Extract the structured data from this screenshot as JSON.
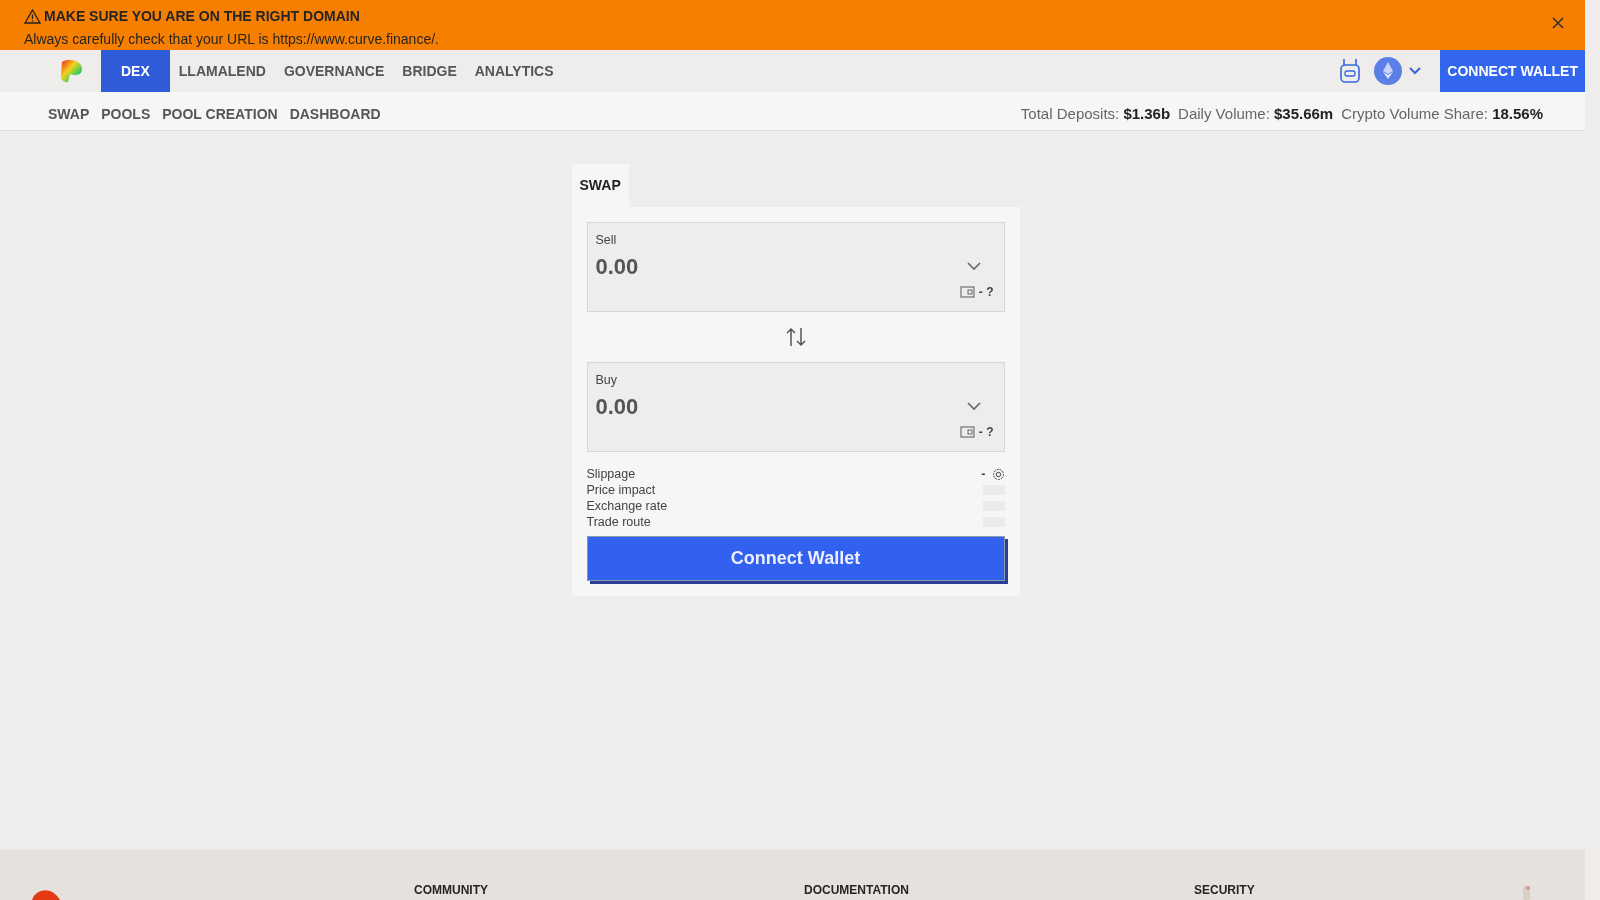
{
  "banner": {
    "title": "MAKE SURE YOU ARE ON THE RIGHT DOMAIN",
    "message": "Always carefully check that your URL is https://www.curve.finance/."
  },
  "nav": {
    "items": [
      {
        "label": "DEX",
        "selected": true
      },
      {
        "label": "LLAMALEND",
        "selected": false
      },
      {
        "label": "GOVERNANCE",
        "selected": false
      },
      {
        "label": "BRIDGE",
        "selected": false
      },
      {
        "label": "ANALYTICS",
        "selected": false
      }
    ],
    "connect": "CONNECT WALLET"
  },
  "subnav": {
    "items": [
      {
        "label": "SWAP",
        "selected": false
      },
      {
        "label": "POOLS",
        "selected": false
      },
      {
        "label": "POOL CREATION",
        "selected": false
      },
      {
        "label": "DASHBOARD",
        "selected": false
      }
    ],
    "stats": [
      {
        "label": "Total Deposits:",
        "value": "$1.36b"
      },
      {
        "label": "Daily Volume:",
        "value": "$35.66m"
      },
      {
        "label": "Crypto Volume Share:",
        "value": "18.56%"
      }
    ]
  },
  "swap": {
    "tabs": [
      {
        "label": "SWAP",
        "selected": true
      }
    ],
    "fields": [
      {
        "label": "Sell",
        "placeholder": "0.00",
        "balance": "- ?"
      },
      {
        "label": "Buy",
        "placeholder": "0.00",
        "balance": "- ?"
      }
    ],
    "details": [
      {
        "label": "Slippage",
        "value": "-"
      },
      {
        "label": "Price impact"
      },
      {
        "label": "Exchange rate"
      },
      {
        "label": "Trade route"
      }
    ],
    "button": "Connect Wallet"
  },
  "footer": {
    "headings": [
      "COMMUNITY",
      "DOCUMENTATION",
      "SECURITY"
    ]
  }
}
